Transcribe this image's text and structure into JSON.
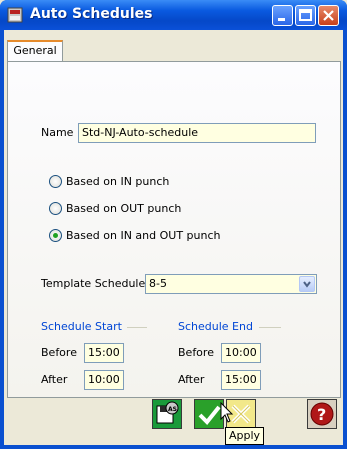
{
  "window": {
    "title": "Auto Schedules"
  },
  "tabs": [
    {
      "label": "General"
    }
  ],
  "form": {
    "name_label": "Name",
    "name_value": "Std-NJ-Auto-schedule",
    "radios": [
      {
        "label": "Based on IN punch",
        "selected": false
      },
      {
        "label": "Based on OUT punch",
        "selected": false
      },
      {
        "label": "Based on IN and OUT punch",
        "selected": true
      }
    ],
    "template_label": "Template Schedule",
    "template_value": "8-5",
    "schedule_start": {
      "title": "Schedule Start",
      "before_label": "Before",
      "before_value": "15:00",
      "after_label": "After",
      "after_value": "10:00"
    },
    "schedule_end": {
      "title": "Schedule End",
      "before_label": "Before",
      "before_value": "10:00",
      "after_label": "After",
      "after_value": "15:00"
    }
  },
  "footer": {
    "tooltip": "Apply",
    "buttons": [
      {
        "name": "save-as",
        "icon": "floppy-as-icon",
        "color": "#1a9a3a"
      },
      {
        "name": "apply",
        "icon": "checkmark-icon",
        "color": "#2aa02a"
      },
      {
        "name": "cancel",
        "icon": "x-icon",
        "color": "#e8d860"
      },
      {
        "name": "help",
        "icon": "question-icon",
        "color": "#b01818"
      }
    ]
  }
}
